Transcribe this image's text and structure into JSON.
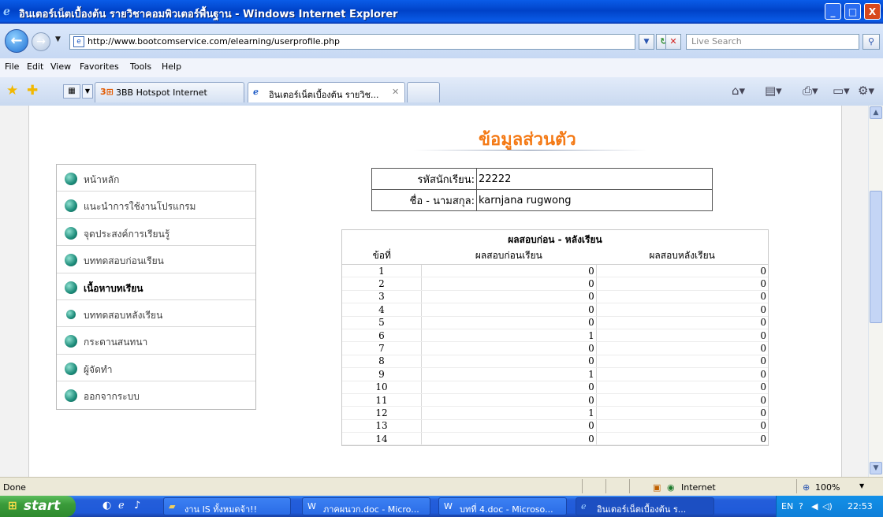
{
  "window": {
    "title": "อินเตอร์เน็ตเบื้องต้น รายวิชาคอมพิวเตอร์พื้นฐาน - Windows Internet Explorer",
    "minimize": "_",
    "maximize": "□",
    "close": "X"
  },
  "address": {
    "url": "http://www.bootcomservice.com/elearning/userprofile.php",
    "search_placeholder": "Live Search"
  },
  "menu": [
    "File",
    "Edit",
    "View",
    "Favorites",
    "Tools",
    "Help"
  ],
  "tabs": [
    {
      "label": "3BB Hotspot Internet",
      "active": false
    },
    {
      "label": "อินเตอร์เน็ตเบื้องต้น รายวิช...",
      "active": true
    }
  ],
  "page": {
    "heading": "ข้อมูลส่วนตัว",
    "sidebar": [
      {
        "label": "หน้าหลัก",
        "bold": false
      },
      {
        "label": "แนะนำการใช้งานโปรแกรม",
        "bold": false
      },
      {
        "label": "จุดประสงค์การเรียนรู้",
        "bold": false
      },
      {
        "label": "บททดสอบก่อนเรียน",
        "bold": false
      },
      {
        "label": "เนื้อหาบทเรียน",
        "bold": true
      },
      {
        "label": "บททดสอบหลังเรียน",
        "bold": false
      },
      {
        "label": "กระดานสนทนา",
        "bold": false
      },
      {
        "label": "ผู้จัดทำ",
        "bold": false
      },
      {
        "label": "ออกจากระบบ",
        "bold": false
      }
    ],
    "student": {
      "id_label": "รหัสนักเรียน:",
      "id_value": "22222",
      "name_label": "ชื่อ - นามสกุล:",
      "name_value": "karnjana rugwong"
    },
    "scores": {
      "caption": "ผลสอบก่อน - หลังเรียน",
      "headers": [
        "ข้อที่",
        "ผลสอบก่อนเรียน",
        "ผลสอบหลังเรียน"
      ],
      "rows": [
        [
          "1",
          "0",
          "0"
        ],
        [
          "2",
          "0",
          "0"
        ],
        [
          "3",
          "0",
          "0"
        ],
        [
          "4",
          "0",
          "0"
        ],
        [
          "5",
          "0",
          "0"
        ],
        [
          "6",
          "1",
          "0"
        ],
        [
          "7",
          "0",
          "0"
        ],
        [
          "8",
          "0",
          "0"
        ],
        [
          "9",
          "1",
          "0"
        ],
        [
          "10",
          "0",
          "0"
        ],
        [
          "11",
          "0",
          "0"
        ],
        [
          "12",
          "1",
          "0"
        ],
        [
          "13",
          "0",
          "0"
        ],
        [
          "14",
          "0",
          "0"
        ]
      ]
    }
  },
  "status": {
    "text": "Done",
    "zone": "Internet",
    "zoom": "100%"
  },
  "taskbar": {
    "start": "start",
    "items": [
      {
        "label": "งาน IS ทั้งหมดจ้า!!",
        "icon": "folder-icon",
        "active": false
      },
      {
        "label": "ภาคผนวก.doc - Micro...",
        "icon": "word-doc-icon",
        "active": false
      },
      {
        "label": "บทที่ 4.doc - Microso...",
        "icon": "word-doc-icon",
        "active": false
      },
      {
        "label": "อินเตอร์เน็ตเบื้องต้น ร...",
        "icon": "ie-icon",
        "active": true
      }
    ],
    "lang": "EN",
    "clock": "22:53"
  },
  "colors": {
    "heading": "#f47a16",
    "titlebar": "#0a5ce8",
    "taskbar": "#245edb",
    "start": "#3a9b3a"
  }
}
